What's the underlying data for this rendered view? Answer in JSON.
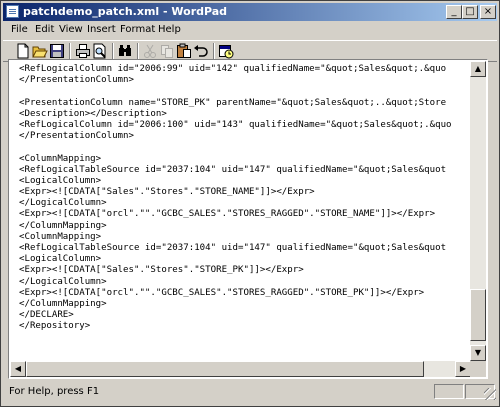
{
  "window": {
    "title": "patchdemo_patch.xml - WordPad",
    "minimize_glyph": "_",
    "maximize_glyph": "□",
    "close_glyph": "×"
  },
  "menu": {
    "items": [
      "File",
      "Edit",
      "View",
      "Insert",
      "Format",
      "Help"
    ]
  },
  "toolbar": {
    "buttons": [
      {
        "name": "new-icon"
      },
      {
        "name": "open-icon"
      },
      {
        "name": "save-icon"
      },
      {
        "name": "print-icon"
      },
      {
        "name": "print-preview-icon"
      },
      {
        "name": "find-icon"
      },
      {
        "name": "cut-icon",
        "disabled": true
      },
      {
        "name": "copy-icon",
        "disabled": true
      },
      {
        "name": "paste-icon"
      },
      {
        "name": "undo-icon"
      },
      {
        "name": "date-time-icon"
      }
    ]
  },
  "document": {
    "lines": [
      "<RefLogicalColumn id=\"2006:99\" uid=\"142\" qualifiedName=\"&quot;Sales&quot;.&quo",
      "</PresentationColumn>",
      "",
      "<PresentationColumn name=\"STORE_PK\" parentName=\"&quot;Sales&quot;..&quot;Store",
      "<Description></Description>",
      "<RefLogicalColumn id=\"2006:100\" uid=\"143\" qualifiedName=\"&quot;Sales&quot;.&quo",
      "</PresentationColumn>",
      "",
      "<ColumnMapping>",
      "<RefLogicalTableSource id=\"2037:104\" uid=\"147\" qualifiedName=\"&quot;Sales&quot",
      "<LogicalColumn>",
      "<Expr><![CDATA[\"Sales\".\"Stores\".\"STORE_NAME\"]]></Expr>",
      "</LogicalColumn>",
      "<Expr><![CDATA[\"orcl\".\"\".\"GCBC_SALES\".\"STORES_RAGGED\".\"STORE_NAME\"]]></Expr>",
      "</ColumnMapping>",
      "<ColumnMapping>",
      "<RefLogicalTableSource id=\"2037:104\" uid=\"147\" qualifiedName=\"&quot;Sales&quot",
      "<LogicalColumn>",
      "<Expr><![CDATA[\"Sales\".\"Stores\".\"STORE_PK\"]]></Expr>",
      "</LogicalColumn>",
      "<Expr><![CDATA[\"orcl\".\"\".\"GCBC_SALES\".\"STORES_RAGGED\".\"STORE_PK\"]]></Expr>",
      "</ColumnMapping>",
      "</DECLARE>",
      "</Repository>"
    ]
  },
  "scrollbar": {
    "up_glyph": "▲",
    "down_glyph": "▼",
    "left_glyph": "◀",
    "right_glyph": "▶"
  },
  "status": {
    "text": "For Help, press F1"
  }
}
